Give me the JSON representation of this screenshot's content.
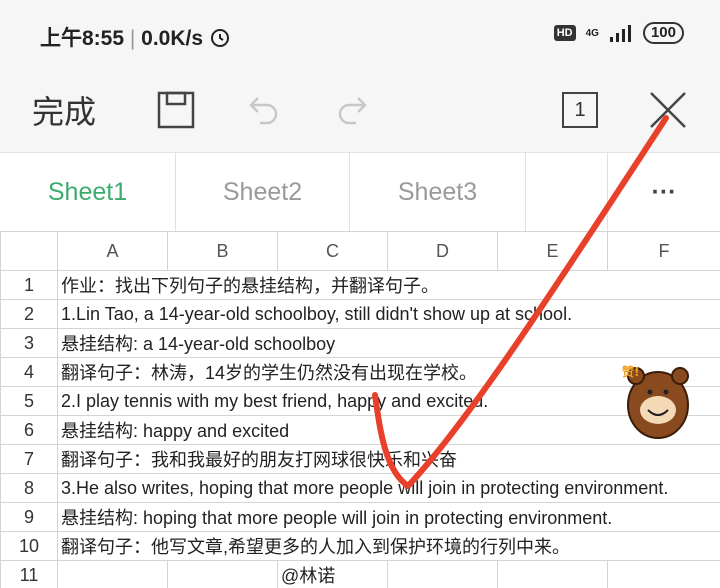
{
  "status": {
    "time": "上午8:55",
    "speed": "0.0K/s",
    "hd": "HD",
    "network": "4G",
    "battery": "100"
  },
  "toolbar": {
    "done": "完成",
    "page_count": "1"
  },
  "sheets": [
    "Sheet1",
    "Sheet2",
    "Sheet3"
  ],
  "sheet_more": "···",
  "columns": [
    "A",
    "B",
    "C",
    "D",
    "E",
    "F"
  ],
  "rows": [
    {
      "num": "1",
      "a": "作业：找出下列句子的悬挂结构，并翻译句子。"
    },
    {
      "num": "2",
      "a": "1.Lin Tao, a 14-year-old schoolboy, still didn't show up at school."
    },
    {
      "num": "3",
      "a": "悬挂结构: a 14-year-old schoolboy"
    },
    {
      "num": "4",
      "a": "翻译句子：林涛，14岁的学生仍然没有出现在学校。"
    },
    {
      "num": "5",
      "a": "2.I play  tennis with my best friend, happy and excited."
    },
    {
      "num": "6",
      "a": "悬挂结构: happy and excited"
    },
    {
      "num": "7",
      "a": "翻译句子：我和我最好的朋友打网球很快乐和兴奋"
    },
    {
      "num": "8",
      "a": "3.He also writes, hoping that more people will join in protecting environment."
    },
    {
      "num": "9",
      "a": "悬挂结构: hoping that more people will join in protecting environment."
    },
    {
      "num": "10",
      "a": "翻译句子：他写文章,希望更多的人加入到保护环境的行列中来。"
    },
    {
      "num": "11",
      "a": "",
      "c": "@林诺"
    }
  ],
  "sticker": {
    "label": "赞!"
  },
  "colors": {
    "accent": "#3bab6f",
    "annotation": "#e8402a"
  }
}
